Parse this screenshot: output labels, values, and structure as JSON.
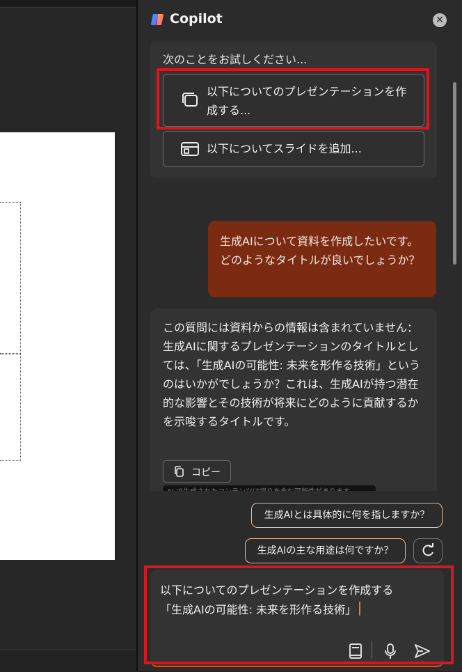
{
  "app": {
    "title": "Copilot",
    "close_icon": "close-icon"
  },
  "suggestions": {
    "label": "次のことをお試しください...",
    "options": [
      {
        "label": "以下についてのプレゼンテーションを作成する...",
        "icon": "presentation-icon"
      },
      {
        "label": "以下についてスライドを追加...",
        "icon": "slide-layout-icon"
      }
    ]
  },
  "conversation": {
    "user_message": "生成AIについて資料を作成したいです。どのようなタイトルが良いでしょうか？",
    "ai_message": "この質問には資料からの情報は含まれていません： 生成AIに関するプレゼンテーションのタイトルとしては、「生成AIの可能性: 未来を形作る技術」というのはいかがでしょうか？これは、生成AIが持つ潜在的な影響とその技術が将来にどのように貢献するかを示唆するタイトルです。",
    "copy_label": "コピー",
    "disclaimer": "AI で生成されたコンテンツは誤りを含む可能性があります"
  },
  "followups": [
    "生成AIとは具体的に何を指しますか？",
    "生成AIの主な用途は何ですか？"
  ],
  "input": {
    "value_line1": "以下についてのプレゼンテーションを作成する",
    "value_line2": "「生成AIの可能性: 未来を形作る技術」"
  },
  "colors": {
    "user_bubble": "#7b2b11",
    "highlight": "#d7171f",
    "accent": "#e07a2a"
  }
}
